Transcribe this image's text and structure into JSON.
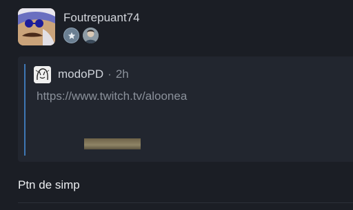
{
  "post": {
    "author": "Foutrepuant74",
    "badges": [
      {
        "icon": "star-badge-icon"
      },
      {
        "icon": "avatar-badge-icon"
      }
    ]
  },
  "quote": {
    "author": "modoPD",
    "separator": "·",
    "time": "2h",
    "link": "https://www.twitch.tv/aloonea"
  },
  "message": "Ptn de simp",
  "colors": {
    "background": "#1b1e25",
    "quote_background": "#22262f",
    "quote_bar": "#3e78b6",
    "muted_text": "#8b919b"
  }
}
